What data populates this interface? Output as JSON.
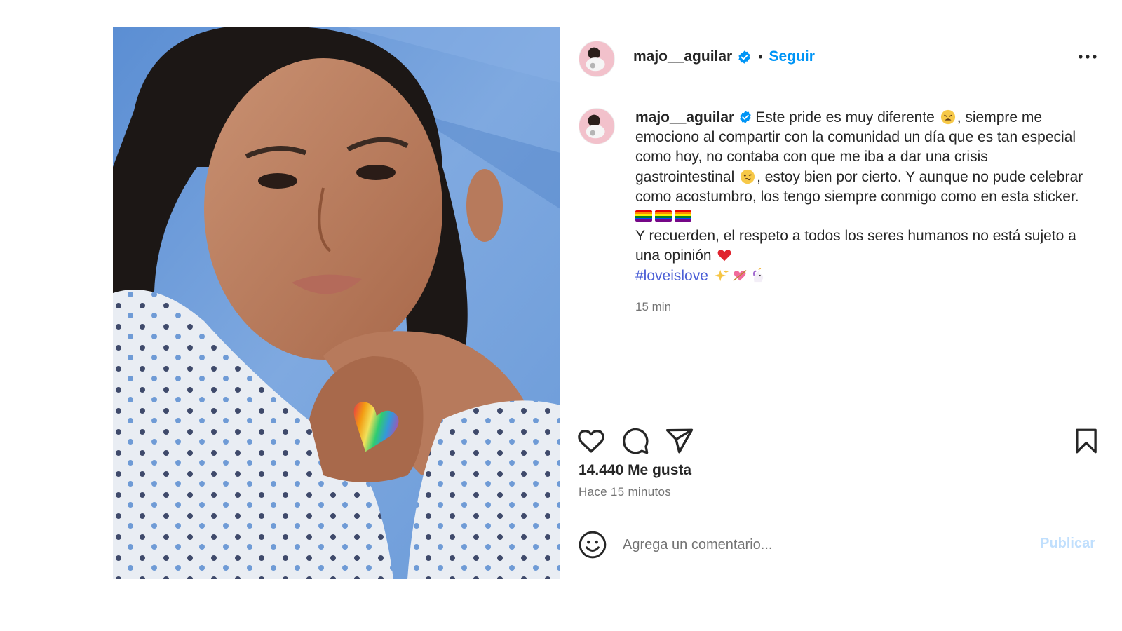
{
  "post": {
    "media_alt": "selfie photo in hospital bed with rainbow heart sticker",
    "user": {
      "username": "majo__aguilar",
      "verified": true,
      "follow_label": "Seguir"
    },
    "header_separator": "•",
    "caption": {
      "username": "majo__aguilar",
      "part1": "Este pride es muy diferente ",
      "part2": ", siempre me emociono al compartir con la comunidad un día que es tan especial como hoy, no contaba con que me iba a dar una crisis gastrointestinal ",
      "part3": ", estoy bien por cierto. Y aunque no pude celebrar como acostumbro, los tengo siempre conmigo como en esta sticker. ",
      "part4": "Y recuerden, el respeto a todos los seres humanos no está sujeto a una opinión ",
      "hashtag": "#loveislove",
      "time": "15 min"
    },
    "likes": "14.440 Me gusta",
    "posted_ago": "Hace 15 minutos",
    "comment": {
      "placeholder": "Agrega un comentario...",
      "publish_label": "Publicar"
    }
  },
  "icons": {
    "more": "more-options-icon",
    "like": "heart-icon",
    "comment": "comment-icon",
    "share": "send-icon",
    "save": "bookmark-icon",
    "emoji": "smiley-icon",
    "verified": "verified-badge-icon"
  },
  "colors": {
    "accent": "#0095f6",
    "publish_disabled": "#c0dffd",
    "verified": "#0095f6",
    "hashtag": "#4b5fd6",
    "muted": "#737373",
    "divider": "#efefef"
  }
}
